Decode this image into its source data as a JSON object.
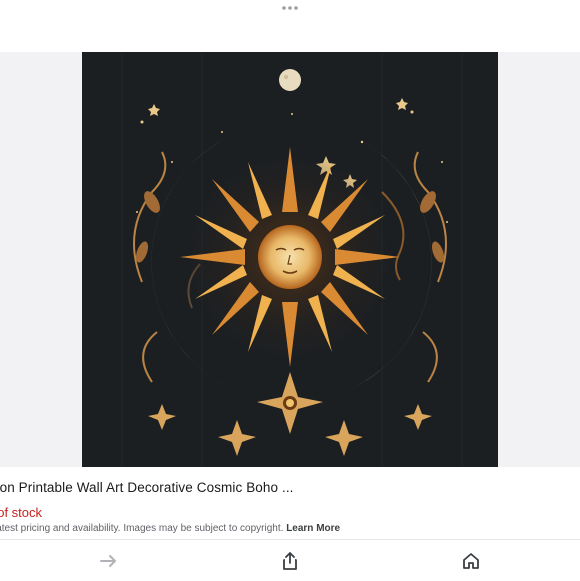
{
  "product": {
    "title": "oon Printable Wall Art Decorative Cosmic Boho ...",
    "availability": "t of stock",
    "disclaimer": "latest pricing and availability. Images may be subject to copyright.",
    "learn_more": "Learn More"
  },
  "icons": {
    "more": "more-horizontal-icon",
    "forward": "arrow-right-icon",
    "share": "share-icon",
    "home": "home-icon"
  },
  "colors": {
    "artwork_background": "#1c1f22",
    "gold": "#e9b96a",
    "stock_red": "#c5221f"
  }
}
